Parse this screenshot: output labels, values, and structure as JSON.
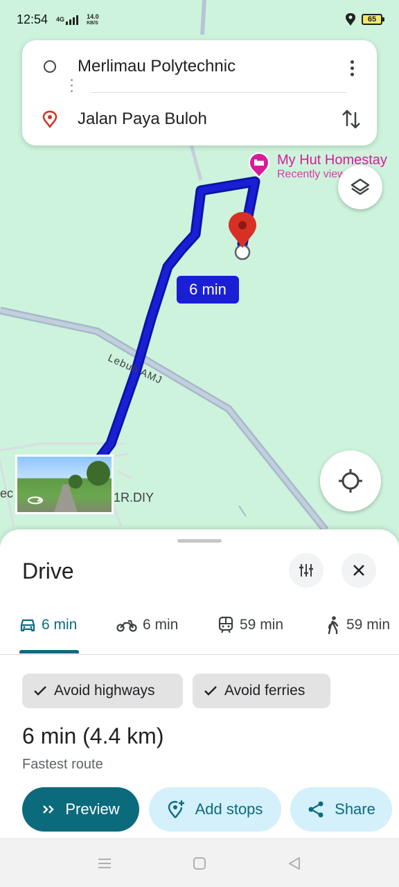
{
  "status_bar": {
    "time": "12:54",
    "network_type": "4G",
    "speed_value": "14.0",
    "speed_unit": "KB/S",
    "battery": "65"
  },
  "directions": {
    "origin": "Merlimau Polytechnic",
    "destination": "Jalan Paya Buloh"
  },
  "map": {
    "poi_name": "My Hut Homestay",
    "poi_subtitle": "Recently viewed",
    "route_time": "6 min",
    "road_label": "Lebuh AMJ",
    "edge_label_left": "ec",
    "edge_label_diy": "1R.DIY",
    "route_color": "#1a1fd6",
    "destination_pin_color": "#d93025",
    "poi_color": "#d81b9a"
  },
  "sheet": {
    "title": "Drive",
    "modes": [
      {
        "name": "car",
        "time": "6 min",
        "active": true
      },
      {
        "name": "motorcycle",
        "time": "6 min",
        "active": false
      },
      {
        "name": "transit",
        "time": "59 min",
        "active": false
      },
      {
        "name": "walk",
        "time": "59 min",
        "active": false
      }
    ],
    "chips": [
      "Avoid highways",
      "Avoid ferries"
    ],
    "summary": "6 min (4.4 km)",
    "summary_sub": "Fastest route",
    "actions": {
      "preview": "Preview",
      "add_stops": "Add stops",
      "share": "Share"
    },
    "accent_color": "#0b6b7d"
  }
}
